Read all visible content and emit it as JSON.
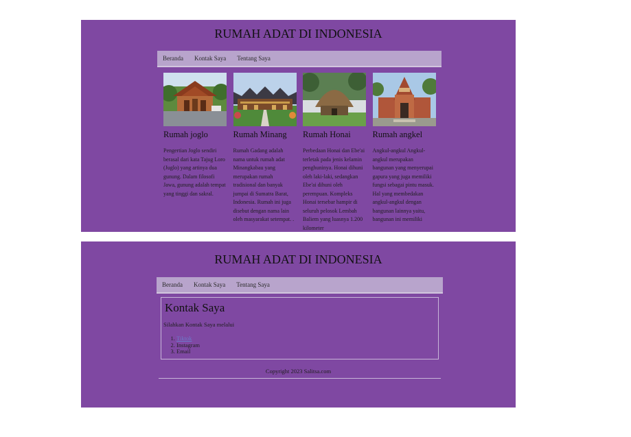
{
  "site": {
    "title": "RUMAH ADAT DI INDONESIA"
  },
  "nav": {
    "items": [
      "Beranda",
      "Kontak Saya",
      "Tentang Saya"
    ]
  },
  "cards": [
    {
      "title": "Rumah joglo",
      "text": "Pengertian Joglo sendiri berasal dari kata Tajug Loro (Juglo) yang artinya dua gunung. Dalam filosofi Jawa, gunung adalah tempat yang tinggi dan sakral.",
      "image": "joglo-house-image"
    },
    {
      "title": "Rumah Minang",
      "text": "Rumah Gadang adalah nama untuk rumah adat Minangkabau yang merupakan rumah tradisional dan banyak jumpai di Sumatra Barat, Indonesia. Rumah ini juga disebut dengan nama lain oleh masyarakat setempat. .",
      "image": "minang-house-image"
    },
    {
      "title": "Rumah Honai",
      "text": "Perbedaan Honai dan Ebe'ai terletak pada jenis kelamin penghuninya. Honai dihuni oleh laki-laki, sedangkan Ebe'ai dihuni oleh perempuan. Kompleks Honai tersebar hampir di seluruh pelosok Lembah Baliem yang luasnya 1.200 kilometer",
      "image": "honai-house-image"
    },
    {
      "title": "Rumah angkel",
      "text": "Angkul-angkul Angkul-angkul merupakan bangunan yang menyerupai gapura yang juga memiliki fungsi sebagai pintu masuk. Hal yang membedakan angkul-angkul dengan bangunan lainnya yaitu, bangunan ini memiliki",
      "image": "angkul-gate-image"
    }
  ],
  "contact": {
    "title": "Kontak Saya",
    "description": "Silahkan Kontak Saya melalui",
    "items": [
      "Tiktok",
      "Instagram",
      "Email"
    ]
  },
  "footer": {
    "copyright": "Copyright 2023 Salitsa.com"
  }
}
